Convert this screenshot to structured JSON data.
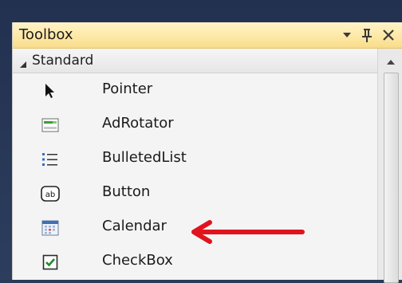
{
  "toolbox": {
    "title": "Toolbox",
    "controls": {
      "dropdown_icon": "dropdown-arrow-icon",
      "pin_icon": "pin-icon",
      "close_icon": "close-icon"
    },
    "group": {
      "label": "Standard",
      "expanded": true
    },
    "items": [
      {
        "label": "Pointer",
        "icon": "pointer-icon"
      },
      {
        "label": "AdRotator",
        "icon": "adrotator-icon"
      },
      {
        "label": "BulletedList",
        "icon": "bulletedlist-icon"
      },
      {
        "label": "Button",
        "icon": "button-icon"
      },
      {
        "label": "Calendar",
        "icon": "calendar-icon"
      },
      {
        "label": "CheckBox",
        "icon": "checkbox-icon"
      }
    ]
  },
  "annotation": {
    "type": "red-arrow",
    "points_to": "Calendar",
    "color": "#e0141e"
  }
}
